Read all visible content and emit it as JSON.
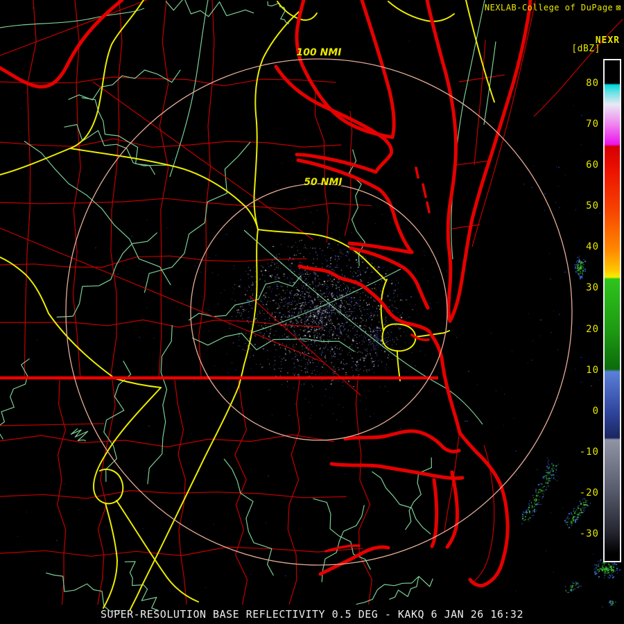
{
  "header": {
    "title": "NEXLAB-College of DuPage",
    "logo_glyph": "⊠"
  },
  "colorbar": {
    "product_label": "NEXR",
    "units_label": "[dBZ]",
    "tick_values": [
      80,
      70,
      60,
      50,
      40,
      30,
      20,
      10,
      0,
      -10,
      -20,
      -30
    ],
    "gradient_stops": [
      [
        0.0,
        "#000000"
      ],
      [
        0.046,
        "#000000"
      ],
      [
        0.049,
        "#00D8D8"
      ],
      [
        0.065,
        "#6FE2E6"
      ],
      [
        0.088,
        "#E9E9F2"
      ],
      [
        0.125,
        "#F08CF0"
      ],
      [
        0.168,
        "#EA14EA"
      ],
      [
        0.172,
        "#D40000"
      ],
      [
        0.22,
        "#EC1200"
      ],
      [
        0.3,
        "#F64400"
      ],
      [
        0.38,
        "#FF8A00"
      ],
      [
        0.418,
        "#FFC400"
      ],
      [
        0.433,
        "#F5EE00"
      ],
      [
        0.437,
        "#2EC41C"
      ],
      [
        0.54,
        "#1E9A12"
      ],
      [
        0.617,
        "#0B6B0B"
      ],
      [
        0.622,
        "#5B80D8"
      ],
      [
        0.7,
        "#31479F"
      ],
      [
        0.754,
        "#1A2660"
      ],
      [
        0.758,
        "#9094A5"
      ],
      [
        0.86,
        "#565A6B"
      ],
      [
        0.944,
        "#23242E"
      ],
      [
        0.985,
        "#000000"
      ],
      [
        1.0,
        "#000000"
      ]
    ]
  },
  "range_rings": {
    "outer_label": "100 NMI",
    "inner_label": "50 NMI"
  },
  "status_bar": {
    "text": "SUPER-RESOLUTION BASE REFLECTIVITY 0.5 DEG - KAKQ 6 JAN 26 16:32"
  },
  "colors": {
    "text_yellow": "#E8E800",
    "status_white": "#EDEDED",
    "coastline_red": "#E60000",
    "county_red": "#C40000",
    "road_green": "#7CCF96",
    "highway_yellow": "#EDED00",
    "range_ring_tan": "#E8AE98",
    "clutter_gray": "#7E7E90",
    "clutter_blue": "#3A48C0",
    "echo_green": "#2FA82F",
    "echo_blue_fringe": "#4878D0"
  }
}
